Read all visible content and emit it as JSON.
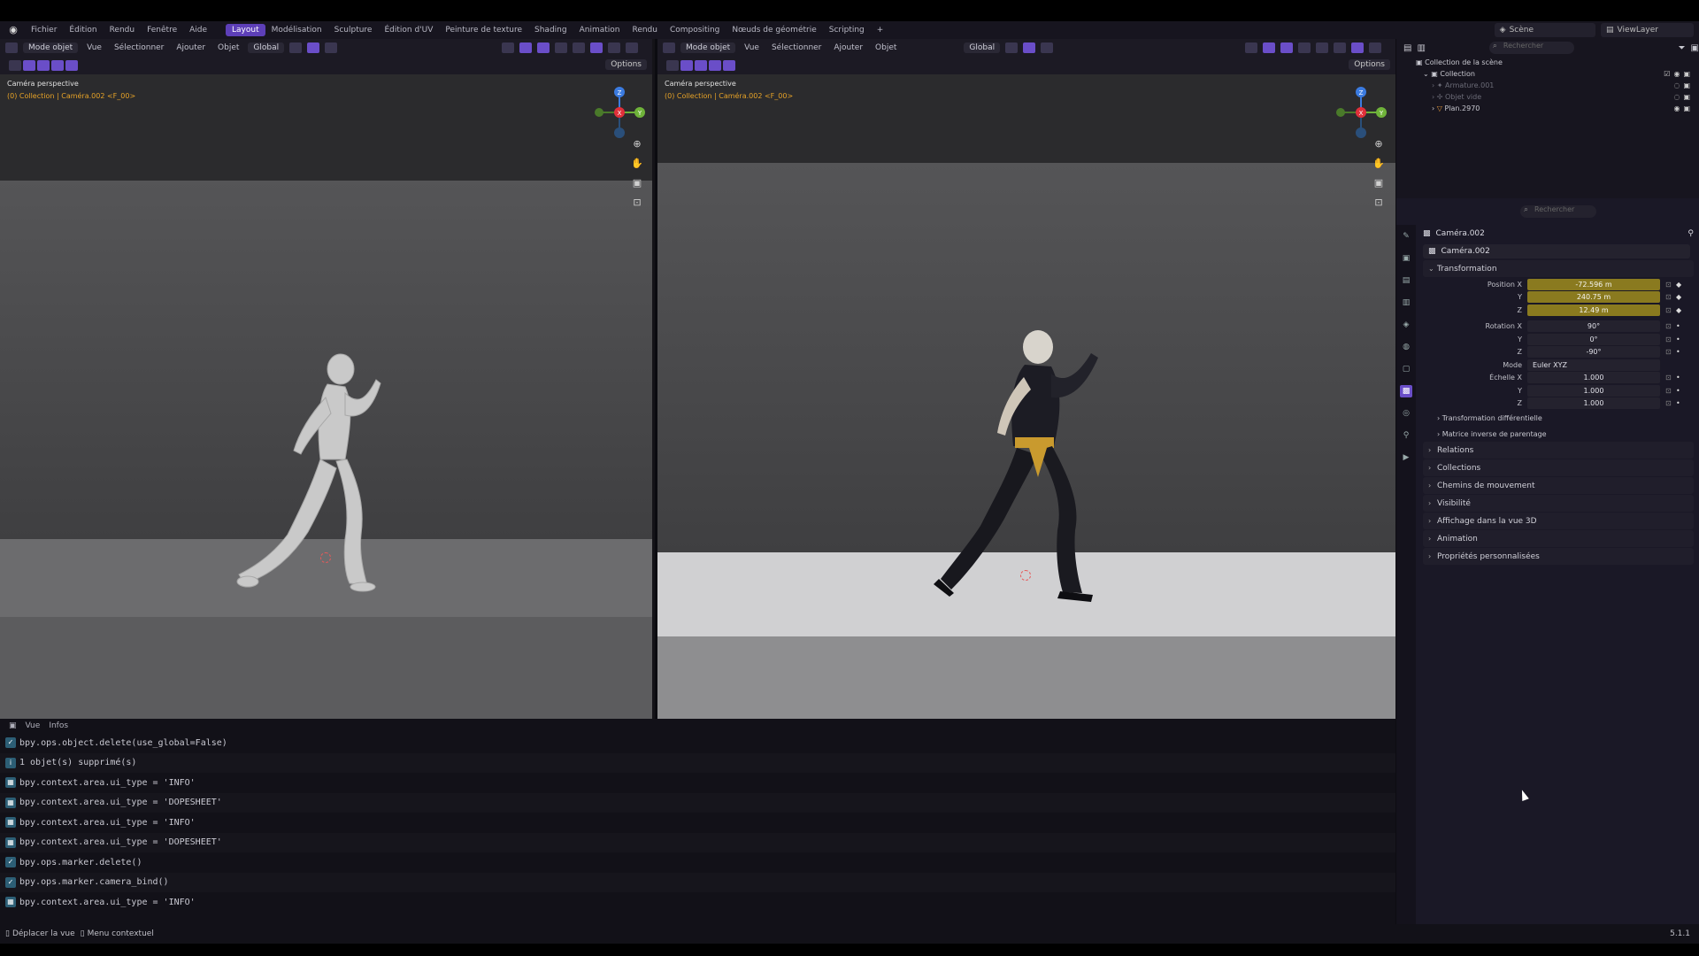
{
  "menubar": {
    "menus": [
      "Fichier",
      "Édition",
      "Rendu",
      "Fenêtre",
      "Aide"
    ],
    "tabs": [
      "Layout",
      "Modélisation",
      "Sculpture",
      "Édition d'UV",
      "Peinture de texture",
      "Shading",
      "Animation",
      "Rendu",
      "Compositing",
      "Nœuds de géométrie",
      "Scripting"
    ],
    "active_tab": "Layout",
    "add_tab": "+",
    "scene": "Scène",
    "view_layer": "ViewLayer"
  },
  "viewport_left": {
    "mode": "Mode objet",
    "menus": [
      "Vue",
      "Sélectionner",
      "Ajouter",
      "Objet"
    ],
    "orientation": "Global",
    "options": "Options",
    "camera_title": "Caméra perspective",
    "camera_sub": "(0) Collection | Caméra.002 <F_00>"
  },
  "viewport_right": {
    "mode": "Mode objet",
    "menus": [
      "Vue",
      "Sélectionner",
      "Ajouter",
      "Objet"
    ],
    "orientation": "Global",
    "options": "Options",
    "camera_title": "Caméra perspective",
    "camera_sub": "(0) Collection | Caméra.002 <F_00>"
  },
  "gizmo": {
    "x": "X",
    "y": "Y",
    "z": "Z"
  },
  "info": {
    "menus": [
      "Vue",
      "Infos"
    ],
    "lines": [
      {
        "icon": "check",
        "text": "bpy.ops.object.delete(use_global=False)"
      },
      {
        "icon": "info",
        "text": "1 objet(s) supprimé(s)"
      },
      {
        "icon": "grid",
        "text": "bpy.context.area.ui_type = 'INFO'"
      },
      {
        "icon": "grid",
        "text": "bpy.context.area.ui_type = 'DOPESHEET'"
      },
      {
        "icon": "grid",
        "text": "bpy.context.area.ui_type = 'INFO'"
      },
      {
        "icon": "grid",
        "text": "bpy.context.area.ui_type = 'DOPESHEET'"
      },
      {
        "icon": "check",
        "text": "bpy.ops.marker.delete()"
      },
      {
        "icon": "check",
        "text": "bpy.ops.marker.camera_bind()"
      },
      {
        "icon": "grid",
        "text": "bpy.context.area.ui_type = 'INFO'"
      }
    ]
  },
  "statusbar": {
    "move_view": "Déplacer la vue",
    "context_menu": "Menu contextuel",
    "version": "5.1.1"
  },
  "outliner": {
    "search_placeholder": "Rechercher",
    "scene_collection": "Collection de la scène",
    "collection": "Collection",
    "items": [
      {
        "name": "Armature.001",
        "dim": true
      },
      {
        "name": "Objet vide",
        "dim": true
      },
      {
        "name": "Plan.2970",
        "dim": false
      }
    ]
  },
  "properties": {
    "search_placeholder": "Rechercher",
    "object_name": "Caméra.002",
    "data_name": "Caméra.002",
    "transform_title": "Transformation",
    "position_label": "Position X",
    "position": [
      "-72.596 m",
      "240.75 m",
      "12.49 m"
    ],
    "rotation_label": "Rotation X",
    "rotation": [
      "90°",
      "0°",
      "-90°"
    ],
    "mode_label": "Mode",
    "mode_value": "Euler XYZ",
    "scale_label": "Échelle X",
    "scale": [
      "1.000",
      "1.000",
      "1.000"
    ],
    "axis_y": "Y",
    "axis_z": "Z",
    "sub_panels": [
      "Transformation différentielle",
      "Matrice inverse de parentage"
    ],
    "panels": [
      "Relations",
      "Collections",
      "Chemins de mouvement",
      "Visibilité",
      "Affichage dans la vue 3D",
      "Animation",
      "Propriétés personnalisées"
    ]
  },
  "colors": {
    "accent": "#5d3fb8",
    "keyframe_field": "#8a7a1f",
    "camera_sub": "#e6a227"
  }
}
